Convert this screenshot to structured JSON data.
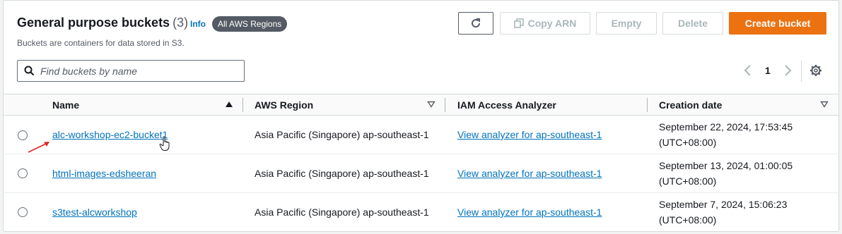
{
  "header": {
    "title": "General purpose buckets",
    "count": "(3)",
    "info": "Info",
    "regions_badge": "All AWS Regions",
    "subtitle": "Buckets are containers for data stored in S3."
  },
  "toolbar": {
    "refresh_icon": "refresh-icon",
    "copy_arn": "Copy ARN",
    "empty": "Empty",
    "delete": "Delete",
    "create": "Create bucket"
  },
  "search": {
    "placeholder": "Find buckets by name",
    "value": ""
  },
  "pagination": {
    "current_page": "1"
  },
  "table": {
    "columns": [
      "Name",
      "AWS Region",
      "IAM Access Analyzer",
      "Creation date"
    ],
    "rows": [
      {
        "name": "alc-workshop-ec2-bucket1",
        "region": "Asia Pacific (Singapore) ap-southeast-1",
        "analyzer": "View analyzer for ap-southeast-1",
        "date_line1": "September 22, 2024, 17:53:45",
        "date_line2": "(UTC+08:00)"
      },
      {
        "name": "html-images-edsheeran",
        "region": "Asia Pacific (Singapore) ap-southeast-1",
        "analyzer": "View analyzer for ap-southeast-1",
        "date_line1": "September 13, 2024, 01:00:05",
        "date_line2": "(UTC+08:00)"
      },
      {
        "name": "s3test-alcworkshop",
        "region": "Asia Pacific (Singapore) ap-southeast-1",
        "analyzer": "View analyzer for ap-southeast-1",
        "date_line1": "September 7, 2024, 15:06:23",
        "date_line2": "(UTC+08:00)"
      }
    ]
  },
  "colors": {
    "primary": "#ec7211",
    "link": "#0073bb",
    "annotation_arrow": "#e0282b"
  }
}
